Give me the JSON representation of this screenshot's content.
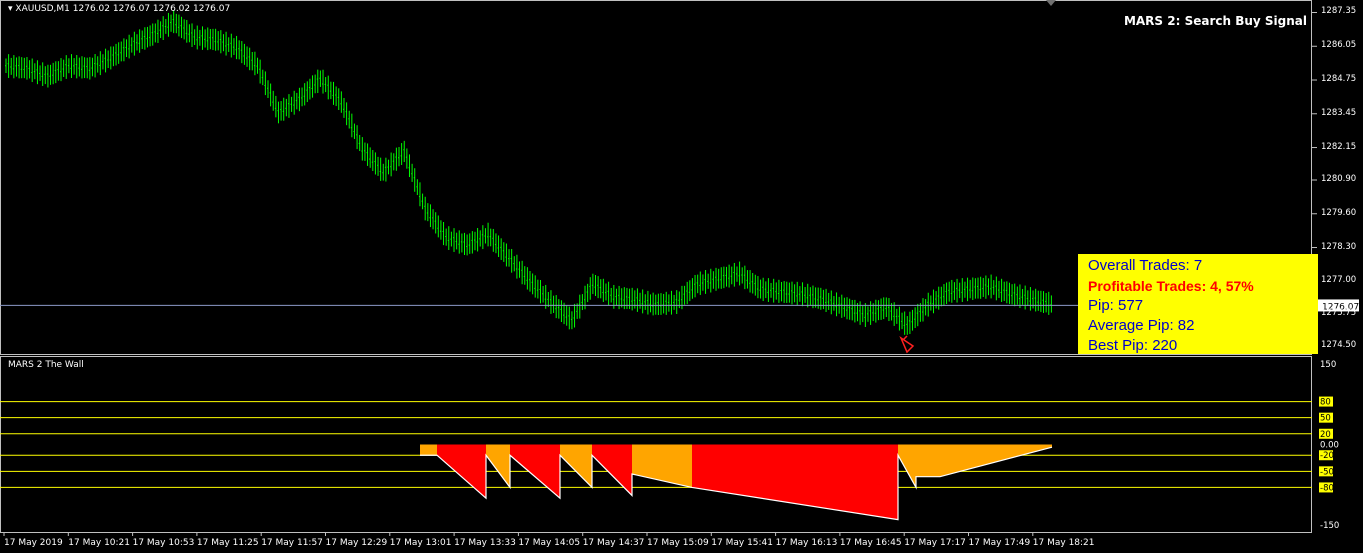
{
  "main": {
    "symbol_info": "XAUUSD,M1  1276.02 1276.07 1276.02 1276.07",
    "signal_title": "MARS 2: Search Buy Signal",
    "current_price": "1276.07",
    "stats": {
      "overall": "Overall Trades: 7",
      "profitable": "Profitable Trades: 4, 57%",
      "pip": "Pip: 577",
      "average": "Average Pip: 82",
      "best": "Best Pip: 220"
    }
  },
  "indicator": {
    "name": "MARS 2 The Wall"
  },
  "colors": {
    "candle": "#00ff00",
    "bar_orange": "#ffa500",
    "bar_red": "#ff0000",
    "level_line": "#ffff00",
    "price_line": "#8c9ac8"
  },
  "chart_data": [
    {
      "type": "line",
      "title": "XAUUSD,M1",
      "ylim": [
        1274.2,
        1287.6
      ],
      "y_ticks": [
        "1287.35",
        "1286.05",
        "1284.75",
        "1283.45",
        "1282.15",
        "1280.90",
        "1279.60",
        "1278.30",
        "1277.00",
        "1275.75",
        "1274.50"
      ],
      "x_ticks": [
        "17 May 2019",
        "17 May 10:21",
        "17 May 10:53",
        "17 May 11:25",
        "17 May 11:57",
        "17 May 12:29",
        "17 May 13:01",
        "17 May 13:33",
        "17 May 14:05",
        "17 May 14:37",
        "17 May 15:09",
        "17 May 15:41",
        "17 May 16:13",
        "17 May 16:45",
        "17 May 17:17",
        "17 May 17:49",
        "17 May 18:21"
      ],
      "series": [
        {
          "x": [
            0,
            8,
            16,
            24,
            32,
            40,
            48,
            56,
            64,
            72,
            80,
            88,
            96,
            104,
            112,
            120,
            128,
            136,
            144,
            152,
            160
          ],
          "values": [
            1285.3,
            1285.2,
            1284.9,
            1285.3,
            1285.2,
            1285.6,
            1286.1,
            1286.5,
            1287.0,
            1286.4,
            1286.3,
            1286.0,
            1285.3,
            1283.5,
            1284.0,
            1284.8,
            1283.9,
            1282.1,
            1281.2,
            1282.0,
            1279.8
          ]
        }
      ],
      "series_tail": {
        "x": [
          168,
          176,
          184,
          192,
          200,
          208,
          216,
          224,
          232,
          240,
          248,
          256,
          264,
          272,
          280,
          288,
          296,
          304,
          312,
          320,
          328,
          336,
          344,
          352
        ],
        "values": [
          1278.7,
          1278.4,
          1278.8,
          1277.9,
          1277.0,
          1276.2,
          1275.5,
          1276.9,
          1276.4,
          1276.3,
          1276.1,
          1276.2,
          1276.9,
          1277.1,
          1277.3,
          1276.7,
          1276.6,
          1276.5,
          1276.3,
          1276.0,
          1275.7,
          1276.0,
          1275.3,
          1276.1
        ]
      },
      "series_end": {
        "x": [
          360,
          368,
          376,
          384,
          392,
          400
        ],
        "values": [
          1276.6,
          1276.7,
          1276.8,
          1276.5,
          1276.3,
          1276.1
        ]
      },
      "current_price": 1276.07
    },
    {
      "type": "bar",
      "title": "MARS 2 The Wall",
      "ylim": [
        -150,
        150
      ],
      "y_ticks": [
        "150",
        "80",
        "50",
        "20",
        "0.00",
        "-20",
        "-50",
        "-80",
        "-150"
      ],
      "levels": [
        80,
        50,
        20,
        -20,
        -50,
        -80
      ],
      "segments": [
        {
          "start": 420,
          "end": 437,
          "color": "orange",
          "from": -20,
          "to": -20
        },
        {
          "start": 437,
          "end": 486,
          "color": "red",
          "from": -20,
          "to": -100
        },
        {
          "start": 486,
          "end": 510,
          "color": "orange",
          "from": -20,
          "to": -80
        },
        {
          "start": 510,
          "end": 560,
          "color": "red",
          "from": -20,
          "to": -100
        },
        {
          "start": 560,
          "end": 592,
          "color": "orange",
          "from": -20,
          "to": -80
        },
        {
          "start": 592,
          "end": 632,
          "color": "red",
          "from": -20,
          "to": -95
        },
        {
          "start": 632,
          "end": 692,
          "color": "orange",
          "from": -55,
          "to": -80
        },
        {
          "start": 692,
          "end": 898,
          "color": "red",
          "from": -80,
          "to": -140
        },
        {
          "start": 898,
          "end": 916,
          "color": "orange",
          "from": -20,
          "to": -80
        },
        {
          "start": 916,
          "end": 940,
          "color": "orange",
          "from": -60,
          "to": -60
        },
        {
          "start": 940,
          "end": 1052,
          "color": "orange",
          "from": -60,
          "to": -5
        }
      ]
    }
  ]
}
